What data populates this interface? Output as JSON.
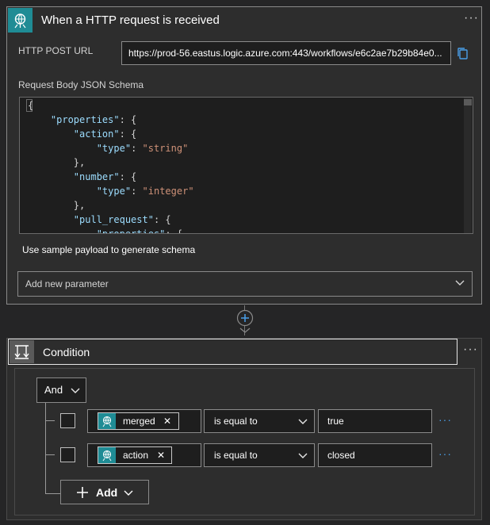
{
  "trigger": {
    "title": "When a HTTP request is received",
    "icon": "http-request-icon",
    "accent_color": "#1f8c95",
    "url_label": "HTTP POST URL",
    "url_value": "https://prod-56.eastus.logic.azure.com:443/workflows/e6c2ae7b29b84e0...",
    "schema_label": "Request Body JSON Schema",
    "schema_lines": [
      "{",
      "    \"properties\": {",
      "        \"action\": {",
      "            \"type\": \"string\"",
      "        },",
      "        \"number\": {",
      "            \"type\": \"integer\"",
      "        },",
      "        \"pull_request\": {",
      "            \"properties\": {"
    ],
    "sample_payload_link": "Use sample payload to generate schema",
    "add_parameter_label": "Add new parameter",
    "more_label": "···"
  },
  "condition": {
    "title": "Condition",
    "icon": "condition-icon",
    "more_label": "···",
    "group_operator": "And",
    "rows": [
      {
        "token": "merged",
        "operator": "is equal to",
        "value": "true"
      },
      {
        "token": "action",
        "operator": "is equal to",
        "value": "closed"
      }
    ],
    "add_label": "Add",
    "row_more_label": "···"
  }
}
